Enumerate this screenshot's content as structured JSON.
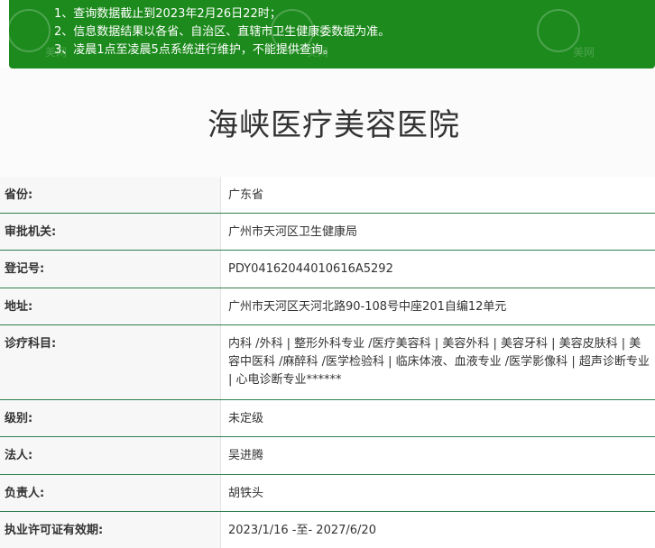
{
  "notice": {
    "lines": [
      "1、查询数据截止到2023年2月26日22时；",
      "2、信息数据结果以各省、自治区、直辖市卫生健康委数据为准。",
      "3、凌晨1点至凌晨5点系统进行维护，不能提供查询。"
    ],
    "watermark_text": "美网"
  },
  "page": {
    "title": "海峡医疗美容医院"
  },
  "info": {
    "province": {
      "label": "省份:",
      "value": "广东省"
    },
    "authority": {
      "label": "审批机关:",
      "value": "广州市天河区卫生健康局"
    },
    "reg_no": {
      "label": "登记号:",
      "value": "PDY04162044010616A5292"
    },
    "address": {
      "label": "地址:",
      "value": "广州市天河区天河北路90-108号中座201自编12单元"
    },
    "departments": {
      "label": "诊疗科目:",
      "value": "内科 /外科 | 整形外科专业 /医疗美容科 | 美容外科 | 美容牙科 | 美容皮肤科 | 美容中医科 /麻醉科 /医学检验科 | 临床体液、血液专业 /医学影像科 | 超声诊断专业 | 心电诊断专业******"
    },
    "level": {
      "label": "级别:",
      "value": "未定级"
    },
    "legal_person": {
      "label": "法人:",
      "value": "吴进腾"
    },
    "person_in_charge": {
      "label": "负责人:",
      "value": "胡铁头"
    },
    "license_validity": {
      "label": "执业许可证有效期:",
      "value": "2023/1/16 -至- 2027/6/20"
    }
  },
  "colors": {
    "notice_bg": "#1c8a1c",
    "row_divider": "#2f7f4f",
    "label_bg": "#f7f7f7"
  }
}
